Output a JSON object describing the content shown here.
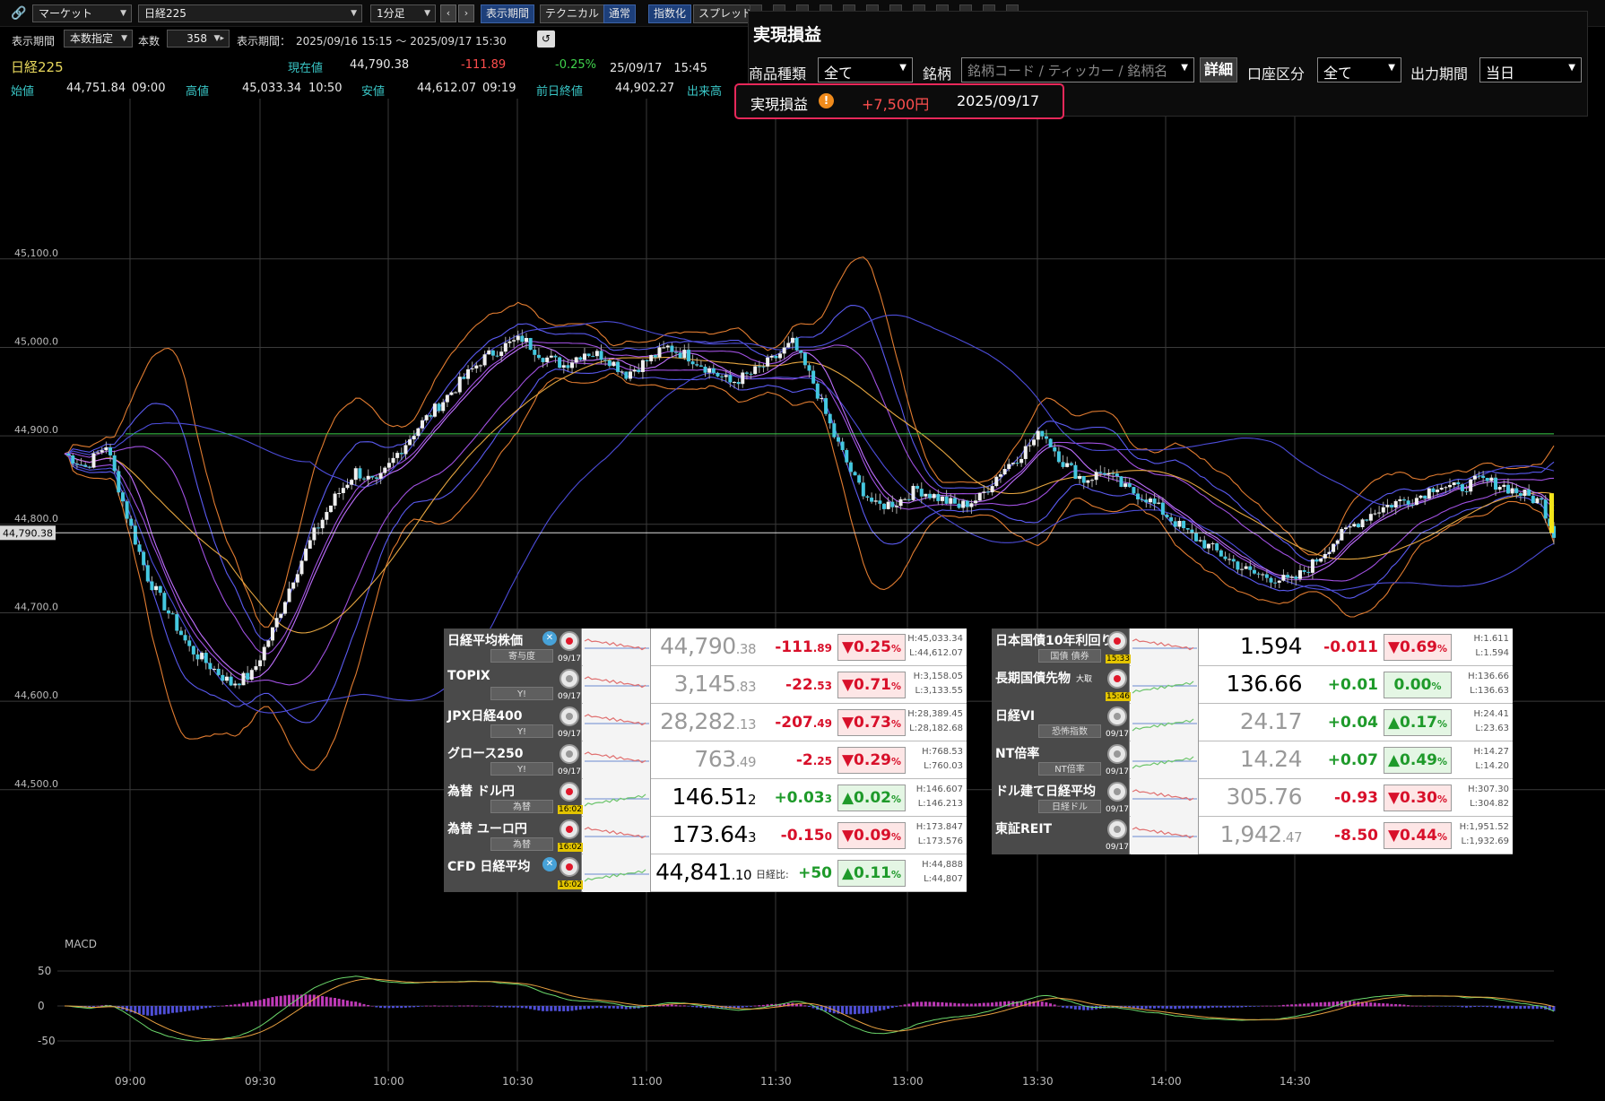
{
  "toolbar": {
    "market_select": "マーケット",
    "symbol_select": "日経225",
    "interval_select": "1分足",
    "buttons": [
      "表示期間",
      "テクニカル",
      "通常",
      "指数化",
      "スプレッド"
    ]
  },
  "period_bar": {
    "label_period": "表示期間",
    "period_mode": "本数指定",
    "label_count": "本数",
    "count_value": "358",
    "range_label": "表示期間：",
    "range_value": "2025/09/16 15:15 ～ 2025/09/17 15:30"
  },
  "quote": {
    "name": "日経225",
    "current_label": "現在値",
    "current": "44,790.38",
    "change": "-111.89",
    "change_pct": "-0.25%",
    "datetime": "25/09/17　15:45",
    "open_label": "始値",
    "open": "44,751.84",
    "open_time": "09:00",
    "high_label": "高値",
    "high": "45,033.34",
    "high_time": "10:50",
    "low_label": "安値",
    "low": "44,612.07",
    "low_time": "09:19",
    "prev_label": "前日終値",
    "prev": "44,902.27",
    "volume_label": "出来高"
  },
  "pnl": {
    "title": "実現損益",
    "product_label": "商品種類",
    "product_value": "全て",
    "symbol_label": "銘柄",
    "symbol_placeholder": "銘柄コード / ティッカー / 銘柄名",
    "detail_button": "詳細",
    "account_label": "口座区分",
    "account_value": "全て",
    "period_label": "出力期間",
    "period_value": "当日",
    "result_label": "実現損益",
    "result_value": "+7,500円",
    "result_date": "2025/09/17"
  },
  "chart_data": {
    "type": "candlestick",
    "y_ticks": [
      "45,100.0",
      "45,000.0",
      "44,900.0",
      "44,800.0",
      "44,700.0",
      "44,600.0",
      "44,500.0"
    ],
    "ylim": [
      44440,
      45190
    ],
    "x_ticks": [
      "09:00",
      "09:30",
      "10:00",
      "10:30",
      "11:00",
      "11:30",
      "13:00",
      "13:30",
      "14:00",
      "14:30"
    ],
    "price_marker": "44,790.38",
    "prev_close_line": 44902.27,
    "close_path": [
      [
        0,
        44880
      ],
      [
        5,
        44865
      ],
      [
        10,
        44890
      ],
      [
        15,
        44810
      ],
      [
        20,
        44740
      ],
      [
        25,
        44700
      ],
      [
        30,
        44660
      ],
      [
        35,
        44640
      ],
      [
        40,
        44620
      ],
      [
        45,
        44630
      ],
      [
        50,
        44680
      ],
      [
        55,
        44740
      ],
      [
        60,
        44790
      ],
      [
        65,
        44830
      ],
      [
        70,
        44860
      ],
      [
        75,
        44845
      ],
      [
        80,
        44880
      ],
      [
        85,
        44910
      ],
      [
        90,
        44935
      ],
      [
        95,
        44960
      ],
      [
        100,
        44985
      ],
      [
        105,
        45000
      ],
      [
        110,
        45010
      ],
      [
        115,
        44990
      ],
      [
        120,
        44980
      ],
      [
        125,
        44995
      ],
      [
        130,
        44990
      ],
      [
        135,
        44970
      ],
      [
        140,
        44985
      ],
      [
        145,
        45000
      ],
      [
        150,
        44990
      ],
      [
        155,
        44975
      ],
      [
        160,
        44960
      ],
      [
        165,
        44970
      ],
      [
        170,
        44985
      ],
      [
        175,
        45005
      ],
      [
        180,
        44960
      ],
      [
        185,
        44900
      ],
      [
        190,
        44850
      ],
      [
        195,
        44820
      ],
      [
        200,
        44825
      ],
      [
        205,
        44840
      ],
      [
        210,
        44830
      ],
      [
        215,
        44820
      ],
      [
        220,
        44830
      ],
      [
        225,
        44860
      ],
      [
        230,
        44880
      ],
      [
        235,
        44905
      ],
      [
        240,
        44870
      ],
      [
        245,
        44850
      ],
      [
        250,
        44860
      ],
      [
        255,
        44840
      ],
      [
        260,
        44830
      ],
      [
        265,
        44810
      ],
      [
        270,
        44790
      ],
      [
        275,
        44775
      ],
      [
        280,
        44760
      ],
      [
        285,
        44745
      ],
      [
        290,
        44740
      ],
      [
        295,
        44735
      ],
      [
        300,
        44755
      ],
      [
        305,
        44780
      ],
      [
        310,
        44800
      ],
      [
        315,
        44815
      ],
      [
        320,
        44825
      ],
      [
        325,
        44830
      ],
      [
        330,
        44845
      ],
      [
        335,
        44840
      ],
      [
        340,
        44850
      ],
      [
        345,
        44845
      ],
      [
        350,
        44835
      ],
      [
        355,
        44825
      ],
      [
        358,
        44790
      ]
    ],
    "macd_label": "MACD",
    "macd_ticks": [
      "50",
      "0",
      "-50"
    ]
  },
  "markets_left": [
    {
      "name": "日経平均株価",
      "sub": "寄与度",
      "date": "09/17",
      "value": "44,790",
      "value_small": ".38",
      "change": "-111",
      "change_small": ".89",
      "pct": "▼0.25",
      "dir": "dn",
      "high": "H:45,033.34",
      "low": "L:44,612.07",
      "x": true,
      "flag": "red"
    },
    {
      "name": "TOPIX",
      "sub": "Y!",
      "date": "09/17",
      "value": "3,145",
      "value_small": ".83",
      "change": "-22",
      "change_small": ".53",
      "pct": "▼0.71",
      "dir": "dn",
      "high": "H:3,158.05",
      "low": "L:3,133.55",
      "flag": "gray"
    },
    {
      "name": "JPX日経400",
      "sub": "Y!",
      "date": "09/17",
      "value": "28,282",
      "value_small": ".13",
      "change": "-207",
      "change_small": ".49",
      "pct": "▼0.73",
      "dir": "dn",
      "high": "H:28,389.45",
      "low": "L:28,182.68",
      "flag": "gray"
    },
    {
      "name": "グロース250",
      "sub": "Y!",
      "date": "09/17",
      "value": "763",
      "value_small": ".49",
      "change": "-2",
      "change_small": ".25",
      "pct": "▼0.29",
      "dir": "dn",
      "high": "H:768.53",
      "low": "L:760.03",
      "flag": "gray"
    },
    {
      "name": "為替 ドル円",
      "sub": "為替",
      "date": "16:02",
      "value": "146.51",
      "value_small": "2",
      "change": "+0.03",
      "change_small": "3",
      "pct": "▲0.02",
      "dir": "up",
      "high": "H:146.607",
      "low": "L:146.213",
      "flag": "red",
      "hl": true,
      "dark": true
    },
    {
      "name": "為替 ユーロ円",
      "sub": "為替",
      "date": "16:02",
      "value": "173.64",
      "value_small": "3",
      "change": "-0.15",
      "change_small": "0",
      "pct": "▼0.09",
      "dir": "dn",
      "high": "H:173.847",
      "low": "L:173.576",
      "flag": "red",
      "hl": true,
      "dark": true
    },
    {
      "name": "CFD 日経平均",
      "sub": "",
      "date": "16:02",
      "value": "44,841",
      "value_small": ".10",
      "cfd_label": "日経比:",
      "change": "+50",
      "change_small": "",
      "pct": "▲0.11",
      "dir": "up",
      "high": "H:44,888",
      "low": "L:44,807",
      "x": true,
      "flag": "red",
      "hl": true,
      "dark": true
    }
  ],
  "markets_right": [
    {
      "name": "日本国債10年利回り",
      "sub": "国債 債券",
      "date": "15:33",
      "value": "1.594",
      "value_small": "",
      "change": "-0.011",
      "change_small": "",
      "pct": "▼0.69",
      "dir": "dn",
      "high": "H:1.611",
      "low": "L:1.594",
      "flag": "red",
      "hl": true,
      "dark": true
    },
    {
      "name": "長期国債先物",
      "name_tag": "大取",
      "sub": "",
      "date": "15:46",
      "value": "136.66",
      "value_small": "",
      "change": "+0.01",
      "change_small": "",
      "pct": "0.00",
      "dir": "up",
      "high": "H:136.66",
      "low": "L:136.63",
      "flag": "red",
      "hl": true,
      "dark": true
    },
    {
      "name": "日経VI",
      "sub": "恐怖指数",
      "date": "09/17",
      "value": "24.17",
      "value_small": "",
      "change": "+0.04",
      "change_small": "",
      "pct": "▲0.17",
      "dir": "up",
      "high": "H:24.41",
      "low": "L:23.63",
      "flag": "gray"
    },
    {
      "name": "NT倍率",
      "sub": "NT倍率",
      "date": "09/17",
      "value": "14.24",
      "value_small": "",
      "change": "+0.07",
      "change_small": "",
      "pct": "▲0.49",
      "dir": "up",
      "high": "H:14.27",
      "low": "L:14.20",
      "flag": "gray"
    },
    {
      "name": "ドル建て日経平均",
      "sub": "日経ドル",
      "date": "09/17",
      "value": "305.76",
      "value_small": "",
      "change": "-0.93",
      "change_small": "",
      "pct": "▼0.30",
      "dir": "dn",
      "high": "H:307.30",
      "low": "L:304.82",
      "flag": "gray"
    },
    {
      "name": "東証REIT",
      "sub": "",
      "date": "09/17",
      "value": "1,942",
      "value_small": ".47",
      "change": "-8.50",
      "change_small": "",
      "pct": "▼0.44",
      "dir": "dn",
      "high": "H:1,951.52",
      "low": "L:1,932.69",
      "flag": "gray"
    }
  ],
  "colors": {
    "panel_accent": "#e8285a",
    "up": "#1e9a2a",
    "down": "#d8102a",
    "quote_name": "#e8d85c"
  }
}
